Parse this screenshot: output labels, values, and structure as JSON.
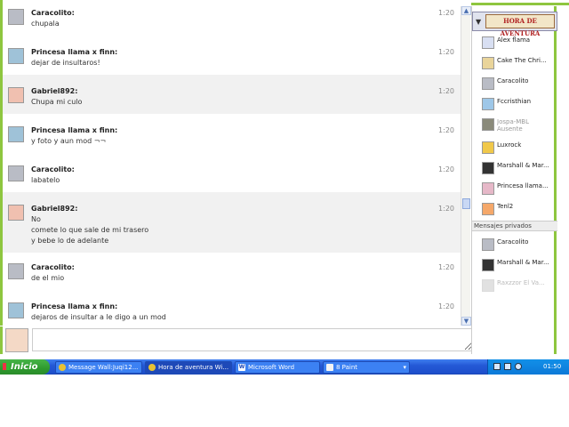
{
  "messages": [
    {
      "user": "Caracolito:",
      "time": "1:20",
      "lines": [
        "chupala"
      ]
    },
    {
      "user": "Princesa llama x finn:",
      "time": "1:20",
      "lines": [
        "dejar de insultaros!"
      ]
    },
    {
      "user": "Gabriel892:",
      "time": "1:20",
      "lines": [
        "Chupa mi culo"
      ]
    },
    {
      "user": "Princesa llama x finn:",
      "time": "1:20",
      "lines": [
        "y foto y aun mod ¬¬"
      ]
    },
    {
      "user": "Caracolito:",
      "time": "1:20",
      "lines": [
        "labatelo"
      ]
    },
    {
      "user": "Gabriel892:",
      "time": "1:20",
      "lines": [
        "No",
        "comete lo que sale de mi trasero",
        "y bebe lo de adelante"
      ]
    },
    {
      "user": "Caracolito:",
      "time": "1:20",
      "lines": [
        "de el mio"
      ]
    },
    {
      "user": "Princesa llama x finn:",
      "time": "1:20",
      "lines": [
        "dejaros de insultar a le digo a un mod"
      ]
    }
  ],
  "sidebar": {
    "logo_text": "HORA DE AVENTURA",
    "users": [
      {
        "name": "Alex flama",
        "status": ""
      },
      {
        "name": "Cake The Chri...",
        "status": ""
      },
      {
        "name": "Caracolito",
        "status": ""
      },
      {
        "name": "Fccristhian",
        "status": ""
      },
      {
        "name": "Jospa-MBL",
        "status": "Ausente"
      },
      {
        "name": "Luxrock",
        "status": ""
      },
      {
        "name": "Marshall & Mar...",
        "status": ""
      },
      {
        "name": "Princesa llama...",
        "status": ""
      },
      {
        "name": "Tenl2",
        "status": ""
      }
    ],
    "private_header": "Mensajes privados",
    "private_users": [
      {
        "name": "Caracolito"
      },
      {
        "name": "Marshall & Mar..."
      },
      {
        "name": "Raxzzor El Va..."
      }
    ]
  },
  "input": {
    "value": ""
  },
  "taskbar": {
    "start_label": "Inicio",
    "tasks": [
      {
        "label": "Message Wall:Juqi12..."
      },
      {
        "label": "Hora de aventura Wi..."
      },
      {
        "label": "Microsoft Word"
      },
      {
        "label": "8 Paint"
      }
    ],
    "word_icon_glyph": "W",
    "dropdown_glyph": "▾",
    "clock": "01:50 p.m."
  },
  "scroll": {
    "up_glyph": "▲",
    "down_glyph": "▼"
  },
  "colors": {
    "accent_green": "#8ec63f",
    "taskbar_blue": "#2459d6",
    "start_green": "#2e9a2e"
  }
}
